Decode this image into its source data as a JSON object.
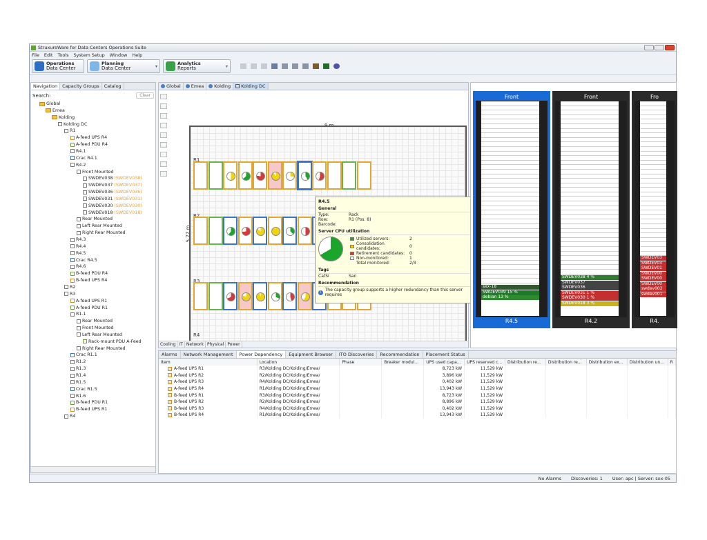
{
  "app": {
    "title": "StruxureWare for Data Centers Operations Suite"
  },
  "menu": [
    "File",
    "Edit",
    "Tools",
    "System Setup",
    "Window",
    "Help"
  ],
  "perspectives": [
    {
      "label": "Operations",
      "sub": "Data Center",
      "color": "#2b6fc4"
    },
    {
      "label": "Planning",
      "sub": "Data Center",
      "color": "#3d8ad6"
    },
    {
      "label": "Analytics",
      "sub": "Reports",
      "color": "#3aa04a"
    }
  ],
  "left": {
    "tabs": [
      "Navigation",
      "Capacity Groups",
      "Catalog"
    ],
    "search_label": "Search:",
    "clear_label": "Clear",
    "tree": [
      {
        "label": "Global",
        "lvl": 0,
        "t": "fold"
      },
      {
        "label": "Emea",
        "lvl": 1,
        "t": "fold"
      },
      {
        "label": "Kolding",
        "lvl": 2,
        "t": "fold"
      },
      {
        "label": "Kolding DC",
        "lvl": 3,
        "t": "i"
      },
      {
        "label": "R1",
        "lvl": 4,
        "t": "i"
      },
      {
        "label": "A-feed UPS R4",
        "lvl": 5,
        "t": "or"
      },
      {
        "label": "A-feed PDU R4",
        "lvl": 5,
        "t": "gr"
      },
      {
        "label": "R4.1",
        "lvl": 5,
        "t": "i"
      },
      {
        "label": "Crac R4.1",
        "lvl": 5,
        "t": "bl"
      },
      {
        "label": "R4.2",
        "lvl": 5,
        "t": "i"
      },
      {
        "label": "Front Mounted",
        "lvl": 6,
        "t": "i"
      },
      {
        "label": "SWDEV038",
        "sub": "(SWDEV038)",
        "lvl": 7,
        "t": "i"
      },
      {
        "label": "SWDEV037",
        "sub": "(SWDEV037)",
        "lvl": 7,
        "t": "i"
      },
      {
        "label": "SWDEV036",
        "sub": "(SWDEV036)",
        "lvl": 7,
        "t": "i"
      },
      {
        "label": "SWDEV031",
        "sub": "(SWDEV031)",
        "lvl": 7,
        "t": "i"
      },
      {
        "label": "SWDEV030",
        "sub": "(SWDEV030)",
        "lvl": 7,
        "t": "i"
      },
      {
        "label": "SWDEV018",
        "sub": "(SWDEV018)",
        "lvl": 7,
        "t": "i"
      },
      {
        "label": "Rear Mounted",
        "lvl": 6,
        "t": "i"
      },
      {
        "label": "Left Rear Mounted",
        "lvl": 6,
        "t": "i"
      },
      {
        "label": "Right Rear Mounted",
        "lvl": 6,
        "t": "i"
      },
      {
        "label": "R4.3",
        "lvl": 5,
        "t": "i"
      },
      {
        "label": "R4.4",
        "lvl": 5,
        "t": "i"
      },
      {
        "label": "R4.5",
        "lvl": 5,
        "t": "i"
      },
      {
        "label": "Crac R4.5",
        "lvl": 5,
        "t": "bl"
      },
      {
        "label": "R4.6",
        "lvl": 5,
        "t": "i"
      },
      {
        "label": "B-feed PDU R4",
        "lvl": 5,
        "t": "gr"
      },
      {
        "label": "B-feed UPS R4",
        "lvl": 5,
        "t": "or"
      },
      {
        "label": "R2",
        "lvl": 4,
        "t": "i"
      },
      {
        "label": "R3",
        "lvl": 4,
        "t": "i"
      },
      {
        "label": "A-feed UPS R1",
        "lvl": 5,
        "t": "or"
      },
      {
        "label": "A-feed PDU R1",
        "lvl": 5,
        "t": "gr"
      },
      {
        "label": "R1.1",
        "lvl": 5,
        "t": "i"
      },
      {
        "label": "Rear Mounted",
        "lvl": 6,
        "t": "i"
      },
      {
        "label": "Front Mounted",
        "lvl": 6,
        "t": "i"
      },
      {
        "label": "Left Rear Mounted",
        "lvl": 6,
        "t": "i"
      },
      {
        "label": "Rack-mount PDU A-Feed",
        "lvl": 7,
        "t": "gr"
      },
      {
        "label": "Right Rear Mounted",
        "lvl": 6,
        "t": "i"
      },
      {
        "label": "Crac R1.1",
        "lvl": 5,
        "t": "bl"
      },
      {
        "label": "R1.2",
        "lvl": 5,
        "t": "i"
      },
      {
        "label": "R1.3",
        "lvl": 5,
        "t": "i"
      },
      {
        "label": "R1.4",
        "lvl": 5,
        "t": "i"
      },
      {
        "label": "R1.5",
        "lvl": 5,
        "t": "i"
      },
      {
        "label": "Crac R1.5",
        "lvl": 5,
        "t": "bl"
      },
      {
        "label": "R1.6",
        "lvl": 5,
        "t": "i"
      },
      {
        "label": "B-feed PDU R1",
        "lvl": 5,
        "t": "gr"
      },
      {
        "label": "B-feed UPS R1",
        "lvl": 5,
        "t": "or"
      },
      {
        "label": "R4",
        "lvl": 4,
        "t": "i"
      }
    ]
  },
  "center": {
    "tabs": [
      "Global",
      "Emea",
      "Kolding",
      "Kolding DC"
    ],
    "width_label": "9 m",
    "height_label": "5.77 m",
    "rows": [
      "R1",
      "R2",
      "R3",
      "R4"
    ],
    "bottom_tabs": [
      "Cooling",
      "IT",
      "Network",
      "Physical",
      "Power"
    ],
    "tooltip": {
      "title": "R4.5",
      "general": "General",
      "type_k": "Type:",
      "type_v": "Rack",
      "row_k": "Row:",
      "row_v": "R1 (Pos. 8)",
      "barcode_k": "Barcode:",
      "cpu": "Server CPU utilization",
      "legend": [
        {
          "label": "Utilized servers:",
          "v": "2",
          "color": "#1ba52a"
        },
        {
          "label": "Consolidation candidates:",
          "v": "0",
          "color": "#f2d40e"
        },
        {
          "label": "Retirement candidates:",
          "v": "0",
          "color": "#d23a3a"
        },
        {
          "label": "Non-monitored:",
          "v": "1",
          "color": "#ffffff"
        },
        {
          "label": "Total monitored:",
          "v": "2/3",
          "color": ""
        }
      ],
      "tags": "Tags",
      "tag_k": "CatSi",
      "tag_v": "San",
      "rec": "Recommendation",
      "rec_text": "The capacity group supports a higher redundancy than this server requires"
    }
  },
  "right": {
    "views": [
      {
        "hdr": "Front",
        "ftr": "R4.5",
        "color": "#1a6ad6"
      },
      {
        "hdr": "Front",
        "ftr": "R4.2",
        "color": "#2a2a2a"
      },
      {
        "hdr": "Fro",
        "ftr": "R4.",
        "color": "#2a2a2a"
      }
    ],
    "r45_servers": [
      {
        "label": "sxx-18",
        "color": "#2e5a2e"
      },
      {
        "label": "SWDEV039   15 %",
        "color": "#1e7a2a"
      },
      {
        "label": "debian        13 %",
        "color": "#2e8a2e"
      }
    ],
    "r42_servers": [
      {
        "label": "SWDEV038      4 %",
        "color": "#2e7d2e"
      },
      {
        "label": "SWDEV037",
        "color": "#444"
      },
      {
        "label": "SWDEV036",
        "color": "#444"
      },
      {
        "label": "SWDEV031      1 %",
        "color": "#c43030"
      },
      {
        "label": "SWDEV030      1 %",
        "color": "#c43030"
      },
      {
        "label": "SWDEV018      3 %",
        "color": "#c9b21e"
      }
    ],
    "r4x_servers": [
      {
        "label": "SWDEV03",
        "color": "#c43030"
      },
      {
        "label": "SWDEV03",
        "color": "#c43030"
      },
      {
        "label": "SWDEV01",
        "color": "#c43030"
      },
      {
        "label": "SWDEV00",
        "color": "#c43030"
      },
      {
        "label": "SWDEV00",
        "color": "#c43030"
      },
      {
        "label": "SWDEV00",
        "color": "#c43030"
      },
      {
        "label": "swdev002",
        "color": "#c43030"
      },
      {
        "label": "swdev001",
        "color": "#c43030"
      }
    ]
  },
  "bottom": {
    "tabs": [
      "Alarms",
      "Network Management",
      "Power Dependency",
      "Equipment Browser",
      "ITO Discoveries",
      "Recommendation",
      "Placement Status"
    ],
    "columns": [
      "Item",
      "Location",
      "Phase",
      "Breaker modul...",
      "UPS used capa...",
      "UPS reserved c...",
      "Distribution re...",
      "Distribution re...",
      "Distribution ex...",
      "Distribution un...",
      "R"
    ],
    "rows": [
      {
        "item": "A-feed UPS R1",
        "loc": "R3/Kolding DC/Kolding/Emea/",
        "used": "8,723 kW",
        "res": "11,529 kW"
      },
      {
        "item": "A-feed UPS R2",
        "loc": "R2/Kolding DC/Kolding/Emea/",
        "used": "3,896 kW",
        "res": "11,529 kW"
      },
      {
        "item": "A-feed UPS R3",
        "loc": "R4/Kolding DC/Kolding/Emea/",
        "used": "0,402 kW",
        "res": "11,529 kW"
      },
      {
        "item": "A-feed UPS R4",
        "loc": "R1/Kolding DC/Kolding/Emea/",
        "used": "13,943 kW",
        "res": "11,529 kW"
      },
      {
        "item": "B-feed UPS R1",
        "loc": "R3/Kolding DC/Kolding/Emea/",
        "used": "8,723 kW",
        "res": "11,529 kW"
      },
      {
        "item": "B-feed UPS R2",
        "loc": "R2/Kolding DC/Kolding/Emea/",
        "used": "8,896 kW",
        "res": "11,529 kW"
      },
      {
        "item": "B-feed UPS R3",
        "loc": "R4/Kolding DC/Kolding/Emea/",
        "used": "0,402 kW",
        "res": "11,529 kW"
      },
      {
        "item": "B-feed UPS R4",
        "loc": "R1/Kolding DC/Kolding/Emea/",
        "used": "13,943 kW",
        "res": "11,529 kW"
      }
    ]
  },
  "status": {
    "alarms": "No Alarms",
    "discoveries": "Discoveries: 1",
    "user": "User: apc | Server: sxx-05"
  }
}
